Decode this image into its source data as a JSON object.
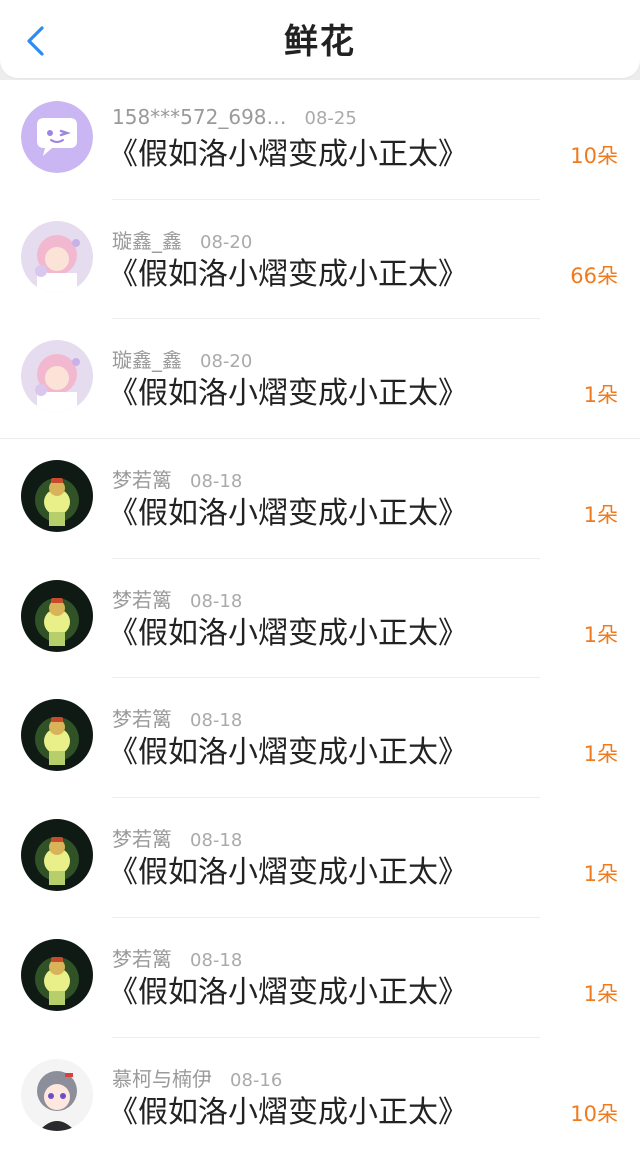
{
  "header": {
    "title": "鲜花",
    "back_icon": "chevron-left-icon"
  },
  "colors": {
    "accent": "#2d8cf0",
    "count": "#f07b1f",
    "name": "#9a9a9a",
    "text": "#222222"
  },
  "items": [
    {
      "name": "158***572_698…",
      "date": "08-25",
      "post": "《假如洛小熠变成小正太》",
      "count": "10朵",
      "avatar": "chat-bubble-avatar"
    },
    {
      "name": "璇鑫_鑫",
      "date": "08-20",
      "post": "《假如洛小熠变成小正太》",
      "count": "66朵",
      "avatar": "anime-girl-avatar"
    },
    {
      "name": "璇鑫_鑫",
      "date": "08-20",
      "post": "《假如洛小熠变成小正太》",
      "count": "1朵",
      "avatar": "anime-girl-avatar"
    },
    {
      "name": "梦若篱",
      "date": "08-18",
      "post": "《假如洛小熠变成小正太》",
      "count": "1朵",
      "avatar": "glowing-figure-avatar"
    },
    {
      "name": "梦若篱",
      "date": "08-18",
      "post": "《假如洛小熠变成小正太》",
      "count": "1朵",
      "avatar": "glowing-figure-avatar"
    },
    {
      "name": "梦若篱",
      "date": "08-18",
      "post": "《假如洛小熠变成小正太》",
      "count": "1朵",
      "avatar": "glowing-figure-avatar"
    },
    {
      "name": "梦若篱",
      "date": "08-18",
      "post": "《假如洛小熠变成小正太》",
      "count": "1朵",
      "avatar": "glowing-figure-avatar"
    },
    {
      "name": "梦若篱",
      "date": "08-18",
      "post": "《假如洛小熠变成小正太》",
      "count": "1朵",
      "avatar": "glowing-figure-avatar"
    },
    {
      "name": "慕柯与楠伊",
      "date": "08-16",
      "post": "《假如洛小熠变成小正太》",
      "count": "10朵",
      "avatar": "chibi-character-avatar"
    }
  ]
}
